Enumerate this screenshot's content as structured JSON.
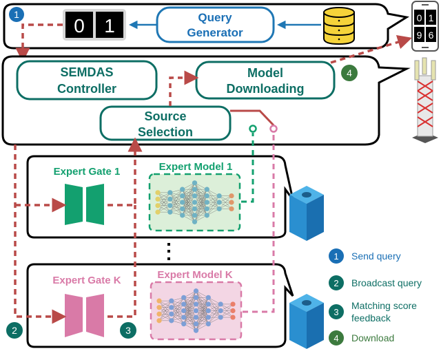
{
  "colors": {
    "teal": "#0d6e64",
    "blue": "#1f77b4",
    "green": "#13a06f",
    "pink": "#d97aa7",
    "red_arrow": "#b94a48",
    "dark_green_badge": "#3c7a3e",
    "db_yellow": "#f5d33a"
  },
  "top_panel": {
    "digits": [
      "0",
      "1"
    ],
    "query_generator": [
      "Query",
      "Generator"
    ]
  },
  "device": {
    "digits": [
      "0",
      "1",
      "9",
      "6"
    ]
  },
  "controller_panel": {
    "semdas": [
      "SEMDAS",
      "Controller"
    ],
    "model_downloading": [
      "Model",
      "Downloading"
    ],
    "source_selection": [
      "Source",
      "Selection"
    ]
  },
  "expert_1": {
    "gate_label": "Expert Gate 1",
    "model_label": "Expert Model 1"
  },
  "expert_k": {
    "gate_label": "Expert Gate K",
    "model_label": "Expert Model K"
  },
  "badges": {
    "b1": "1",
    "b2": "2",
    "b3": "3",
    "b4": "4"
  },
  "legend": [
    {
      "num": "1",
      "text": [
        "Send query"
      ],
      "color": "#1a6fb5"
    },
    {
      "num": "2",
      "text": [
        "Broadcast query"
      ],
      "color": "#0d6e64"
    },
    {
      "num": "3",
      "text": [
        "Matching score",
        "feedback"
      ],
      "color": "#0d6e64"
    },
    {
      "num": "4",
      "text": [
        "Download"
      ],
      "color": "#3c7a3e"
    }
  ]
}
